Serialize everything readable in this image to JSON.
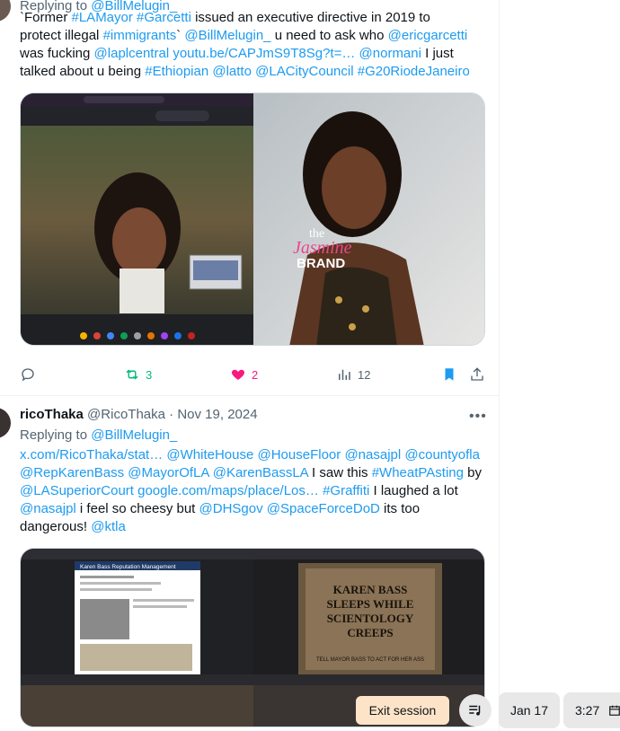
{
  "tweet1": {
    "replying_prefix": "Replying to ",
    "replying_handle": "@BillMelugin_",
    "lines": [
      [
        {
          "t": "`Former ",
          "link": false
        },
        {
          "t": "#LAMayor",
          "link": true
        },
        {
          "t": " ",
          "link": false
        },
        {
          "t": "#Garcetti",
          "link": true
        },
        {
          "t": " issued an executive directive in 2019 to",
          "link": false
        }
      ],
      [
        {
          "t": "protect illegal ",
          "link": false
        },
        {
          "t": "#immigrants",
          "link": true
        },
        {
          "t": "` ",
          "link": false
        },
        {
          "t": "@BillMelugin_",
          "link": true
        },
        {
          "t": " u need to ask who ",
          "link": false
        },
        {
          "t": "@ericgarcetti",
          "link": true
        }
      ],
      [
        {
          "t": "was fucking ",
          "link": false
        },
        {
          "t": "@laplcentral",
          "link": true
        },
        {
          "t": " ",
          "link": false
        },
        {
          "t": "youtu.be/CAPJmS9T8Sg?t=…",
          "link": true
        },
        {
          "t": "  ",
          "link": false
        },
        {
          "t": "@normani",
          "link": true
        },
        {
          "t": " I just",
          "link": false
        }
      ],
      [
        {
          "t": "talked about u being ",
          "link": false
        },
        {
          "t": "#Ethiopian",
          "link": true
        },
        {
          "t": " ",
          "link": false
        },
        {
          "t": "@latto",
          "link": true
        },
        {
          "t": " ",
          "link": false
        },
        {
          "t": "@LACityCouncil",
          "link": true
        },
        {
          "t": " ",
          "link": false
        },
        {
          "t": "#G20RiodeJaneiro",
          "link": true
        }
      ]
    ],
    "media_overlay_text": [
      "the",
      "Jasmine",
      "BRAND"
    ],
    "stats": {
      "replies": "",
      "retweets": "3",
      "likes": "2",
      "views": "12"
    }
  },
  "tweet2": {
    "author_name": "ricoThaka",
    "author_handle": "@RicoThaka",
    "separator": " · ",
    "date": "Nov 19, 2024",
    "replying_prefix": "Replying to ",
    "replying_handle": "@BillMelugin_",
    "lines": [
      [
        {
          "t": "x.com/RicoThaka/stat…",
          "link": true
        },
        {
          "t": " ",
          "link": false
        },
        {
          "t": "@WhiteHouse",
          "link": true
        },
        {
          "t": " ",
          "link": false
        },
        {
          "t": "@HouseFloor",
          "link": true
        },
        {
          "t": " ",
          "link": false
        },
        {
          "t": "@nasajpl",
          "link": true
        },
        {
          "t": " ",
          "link": false
        },
        {
          "t": "@countyofla",
          "link": true
        }
      ],
      [
        {
          "t": "@RepKarenBass",
          "link": true
        },
        {
          "t": " ",
          "link": false
        },
        {
          "t": "@MayorOfLA",
          "link": true
        },
        {
          "t": " ",
          "link": false
        },
        {
          "t": "@KarenBassLA",
          "link": true
        },
        {
          "t": " I saw this ",
          "link": false
        },
        {
          "t": "#WheatPAsting",
          "link": true
        },
        {
          "t": " by",
          "link": false
        }
      ],
      [
        {
          "t": "@LASuperiorCourt",
          "link": true
        },
        {
          "t": " ",
          "link": false
        },
        {
          "t": "google.com/maps/place/Los…",
          "link": true
        },
        {
          "t": " ",
          "link": false
        },
        {
          "t": "#Graffiti",
          "link": true
        },
        {
          "t": " I laughed a lot",
          "link": false
        }
      ],
      [
        {
          "t": "@nasajpl",
          "link": true
        },
        {
          "t": " i feel so cheesy but ",
          "link": false
        },
        {
          "t": "@DHSgov",
          "link": true
        },
        {
          "t": " ",
          "link": false
        },
        {
          "t": "@SpaceForceDoD",
          "link": true
        },
        {
          "t": " its too",
          "link": false
        }
      ],
      [
        {
          "t": "dangerous! ",
          "link": false
        },
        {
          "t": "@ktla",
          "link": true
        }
      ]
    ],
    "media_left_title": "Karen Bass Reputation Management",
    "media_right_text": [
      "KAREN BASS",
      "SLEEPS WHILE",
      "SCIENTOLOGY",
      "CREEPS",
      "TELL MAYOR BASS TO ACT FOR HER ASS"
    ]
  },
  "bottom_bar": {
    "exit_label": "Exit session",
    "date_label": "Jan 17",
    "time_label": "3:27"
  },
  "colors": {
    "link": "#1d9bf0",
    "muted": "#536471",
    "text": "#0f1419",
    "like": "#f91880",
    "retweet": "#00ba7c",
    "bookmark": "#1d9bf0",
    "exit_bg": "#fde4c8"
  }
}
